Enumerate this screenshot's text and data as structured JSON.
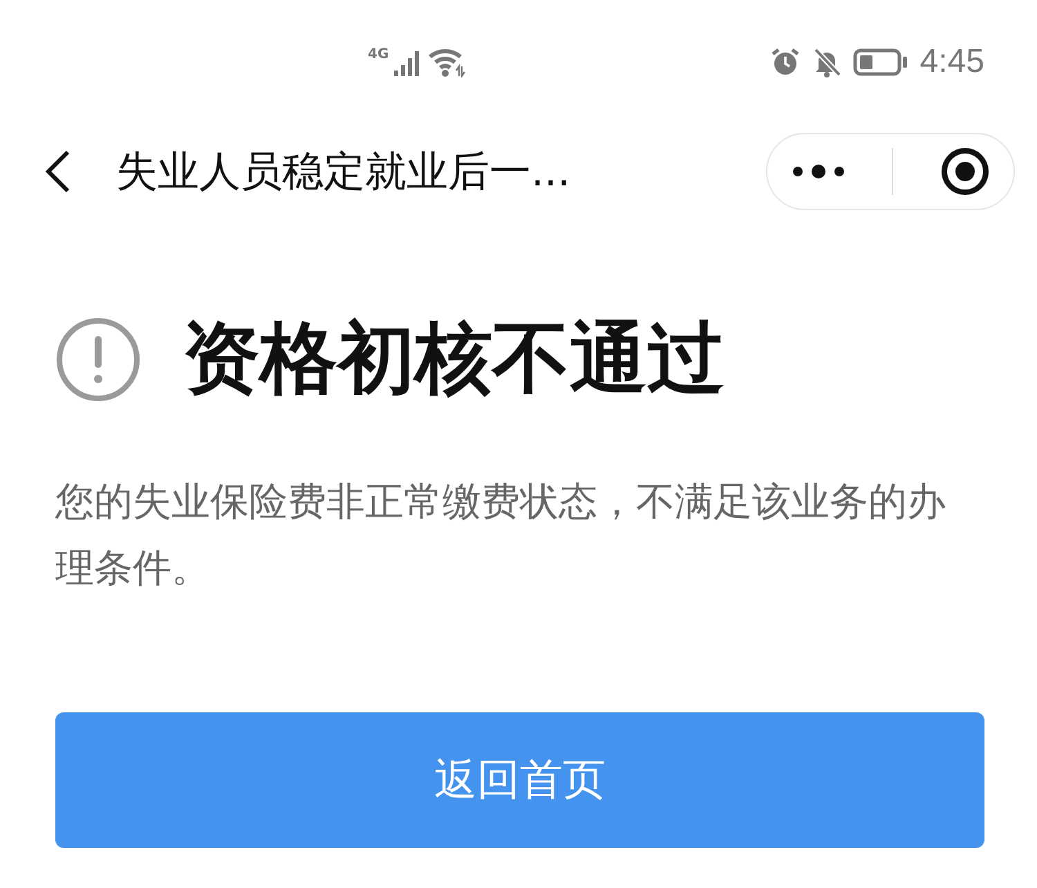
{
  "status_bar": {
    "network": "4G",
    "time": "4:45"
  },
  "nav_bar": {
    "title": "失业人员稳定就业后一..."
  },
  "result": {
    "title": "资格初核不通过",
    "message": "您的失业保险费非正常缴费状态，不满足该业务的办理条件。"
  },
  "buttons": [
    {
      "label": "返回首页"
    }
  ]
}
